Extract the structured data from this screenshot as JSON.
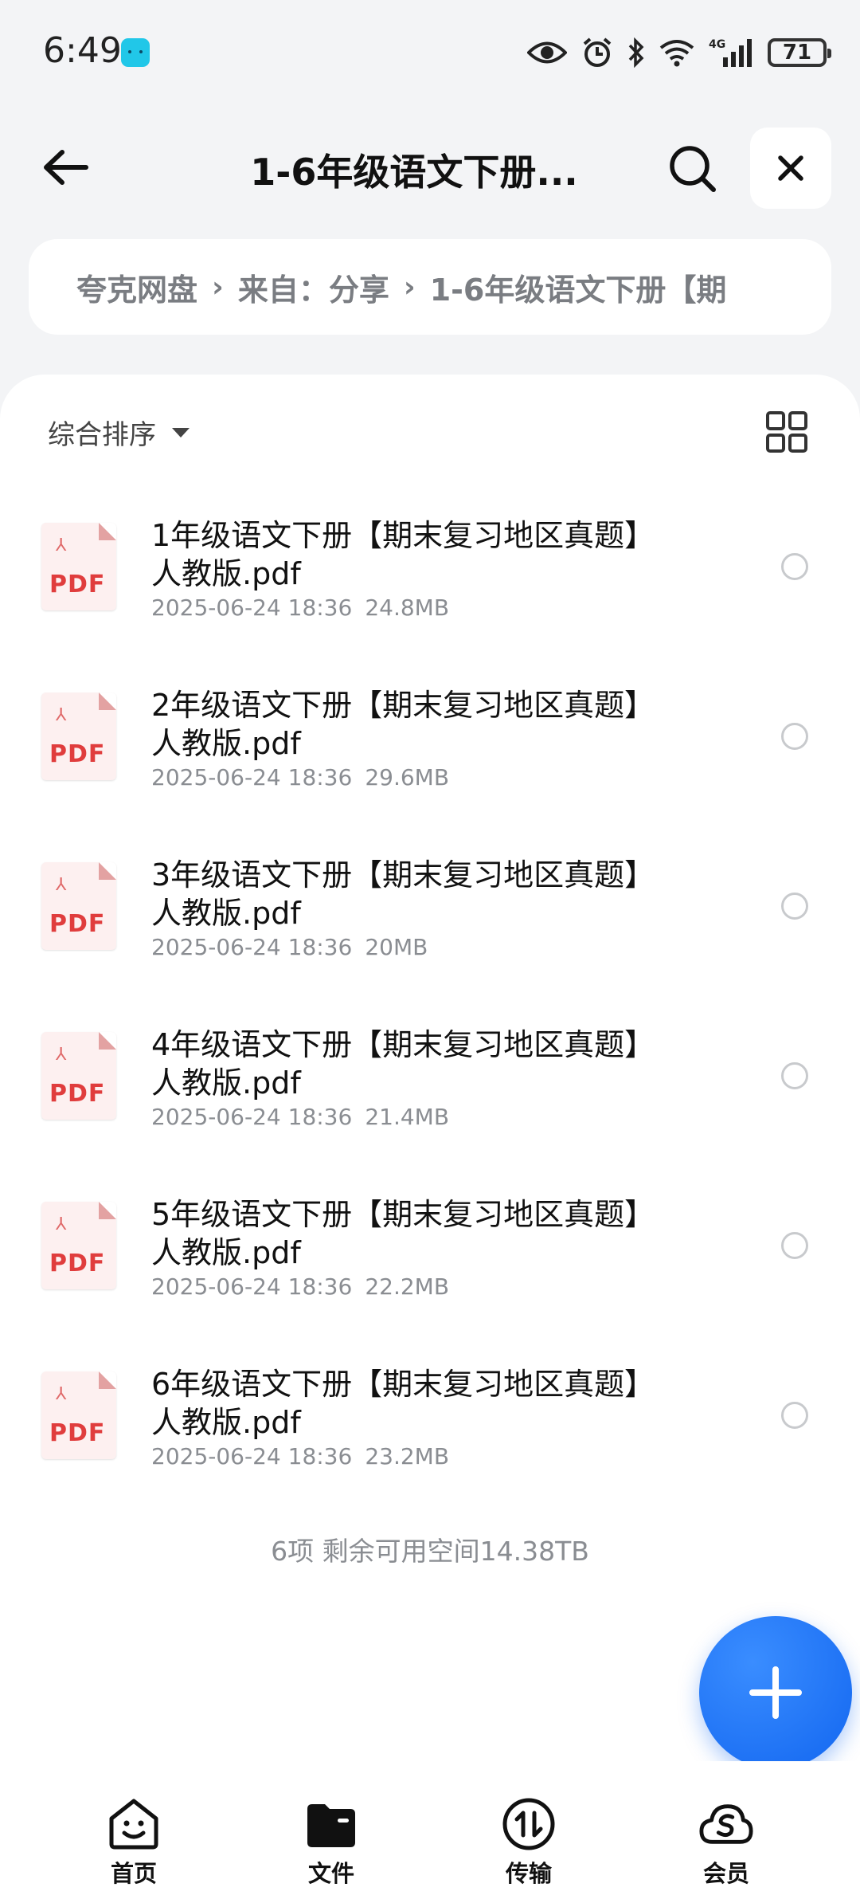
{
  "status_bar": {
    "time": "6:49",
    "battery": "71",
    "network": "4G"
  },
  "header": {
    "title": "1-6年级语文下册..."
  },
  "breadcrumb": [
    "夸克网盘",
    "来自：分享",
    "1-6年级语文下册【期"
  ],
  "sort": {
    "label": "综合排序"
  },
  "files": [
    {
      "name": "1年级语文下册【期末复习地区真题】人教版.pdf",
      "date": "2025-06-24 18:36",
      "size": "24.8MB",
      "icon": "PDF"
    },
    {
      "name": "2年级语文下册【期末复习地区真题】人教版.pdf",
      "date": "2025-06-24 18:36",
      "size": "29.6MB",
      "icon": "PDF"
    },
    {
      "name": "3年级语文下册【期末复习地区真题】人教版.pdf",
      "date": "2025-06-24 18:36",
      "size": "20MB",
      "icon": "PDF"
    },
    {
      "name": "4年级语文下册【期末复习地区真题】人教版.pdf",
      "date": "2025-06-24 18:36",
      "size": "21.4MB",
      "icon": "PDF"
    },
    {
      "name": "5年级语文下册【期末复习地区真题】人教版.pdf",
      "date": "2025-06-24 18:36",
      "size": "22.2MB",
      "icon": "PDF"
    },
    {
      "name": "6年级语文下册【期末复习地区真题】人教版.pdf",
      "date": "2025-06-24 18:36",
      "size": "23.2MB",
      "icon": "PDF"
    }
  ],
  "footer": {
    "summary": "6项 剩余可用空间14.38TB"
  },
  "bottom_nav": [
    {
      "label": "首页",
      "icon": "home-face-icon"
    },
    {
      "label": "文件",
      "icon": "folder-icon"
    },
    {
      "label": "传输",
      "icon": "transfer-icon"
    },
    {
      "label": "会员",
      "icon": "cloud-s-icon"
    }
  ],
  "colors": {
    "accent": "#1266f0",
    "pdf_red": "#e03d3d",
    "background": "#f3f4f6"
  }
}
